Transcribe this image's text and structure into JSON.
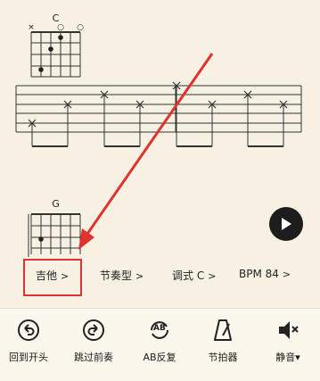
{
  "chords": [
    {
      "name": "C",
      "markers": [
        "×",
        "",
        "",
        "○",
        "",
        "○"
      ]
    },
    {
      "name": "G",
      "markers": [
        "",
        "",
        "",
        "",
        "",
        ""
      ]
    }
  ],
  "options": [
    {
      "label": "吉他"
    },
    {
      "label": "节奏型"
    },
    {
      "label": "调式 C"
    },
    {
      "label": "BPM 84"
    }
  ],
  "toolbar": [
    {
      "label": "回到开头",
      "icon": "undo-circle-icon"
    },
    {
      "label": "跳过前奏",
      "icon": "redo-circle-icon"
    },
    {
      "label": "AB反复",
      "icon": "ab-repeat-icon",
      "badge": "AB"
    },
    {
      "label": "节拍器",
      "icon": "metronome-icon"
    },
    {
      "label": "静音",
      "icon": "speaker-mute-icon"
    }
  ],
  "colors": {
    "background": "#f7f1e3",
    "annotation": "#e0332e",
    "ink": "#1a1a1a"
  }
}
